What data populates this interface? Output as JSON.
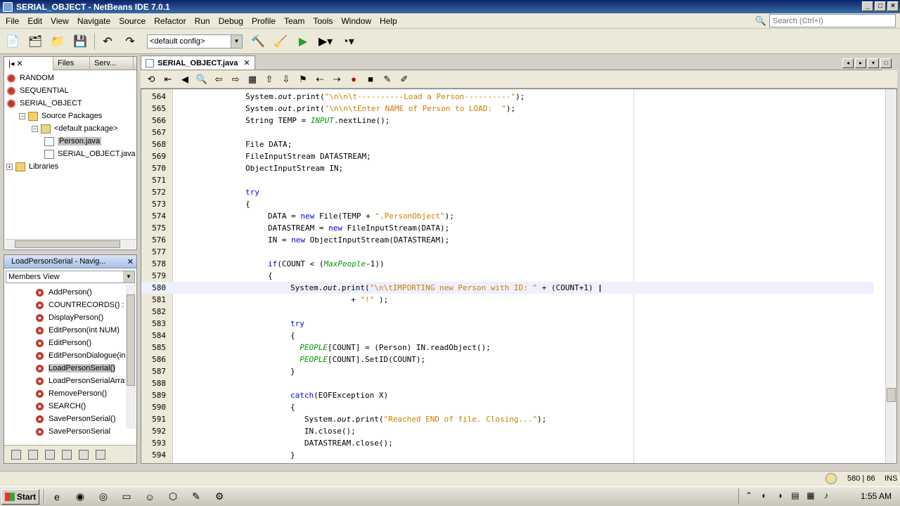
{
  "window": {
    "title": "SERIAL_OBJECT - NetBeans IDE 7.0.1"
  },
  "menu": [
    "File",
    "Edit",
    "View",
    "Navigate",
    "Source",
    "Refactor",
    "Run",
    "Debug",
    "Profile",
    "Team",
    "Tools",
    "Window",
    "Help"
  ],
  "search": {
    "placeholder": "Search (Ctrl+I)"
  },
  "toolbar": {
    "config": "<default config>"
  },
  "projects_panel": {
    "tabs": [
      "Files",
      "Serv..."
    ],
    "tree": [
      {
        "label": "RANDOM",
        "indent": 0,
        "icon": "project-icon"
      },
      {
        "label": "SEQUENTIAL",
        "indent": 0,
        "icon": "project-icon"
      },
      {
        "label": "SERIAL_OBJECT",
        "indent": 0,
        "icon": "project-icon"
      },
      {
        "label": "Source Packages",
        "indent": 1,
        "icon": "folder-icon"
      },
      {
        "label": "<default package>",
        "indent": 2,
        "icon": "package-icon"
      },
      {
        "label": "Person.java",
        "indent": 3,
        "icon": "java-file-icon",
        "selected": true
      },
      {
        "label": "SERIAL_OBJECT.java",
        "indent": 3,
        "icon": "java-file-icon"
      },
      {
        "label": "Libraries",
        "indent": 0,
        "icon": "folder-icon"
      }
    ]
  },
  "navigator": {
    "title": "LoadPersonSerial - Navig...",
    "view": "Members View",
    "members": [
      "AddPerson()",
      "COUNTRECORDS() : int",
      "DisplayPerson()",
      "EditPerson(int NUM)",
      "EditPerson()",
      "EditPersonDialogue(int",
      "LoadPersonSerial()",
      "LoadPersonSerialArray",
      "RemovePerson()",
      "SEARCH()",
      "SavePersonSerial()",
      "SavePersonSerial"
    ],
    "selected_index": 6
  },
  "editor": {
    "tab": "SERIAL_OBJECT.java",
    "current_line": 580,
    "lines": [
      {
        "n": "564",
        "ind": 0,
        "html": "System.<span class=\"static\">out</span>.print(<span class=\"str\">\"\\n\\n\\t----------Load a Person----------\"</span>);"
      },
      {
        "n": "565",
        "ind": 0,
        "html": "System.<span class=\"static\">out</span>.print(<span class=\"str\">\"\\n\\n\\tEnter NAME of Person to LOAD:  \"</span>);"
      },
      {
        "n": "566",
        "ind": 0,
        "html": "String TEMP = <span class=\"fld\">INPUT</span>.nextLine();"
      },
      {
        "n": "567",
        "ind": 0,
        "html": ""
      },
      {
        "n": "568",
        "ind": 0,
        "html": "File DATA;"
      },
      {
        "n": "569",
        "ind": 0,
        "html": "FileInputStream DATASTREAM;"
      },
      {
        "n": "570",
        "ind": 0,
        "html": "ObjectInputStream IN;"
      },
      {
        "n": "571",
        "ind": 0,
        "html": ""
      },
      {
        "n": "572",
        "ind": 0,
        "html": "<span class=\"kw\">try</span>"
      },
      {
        "n": "573",
        "ind": 0,
        "html": "{"
      },
      {
        "n": "574",
        "ind": 1,
        "html": "DATA = <span class=\"kw\">new</span> File(TEMP + <span class=\"str\">\".PersonObject\"</span>);"
      },
      {
        "n": "575",
        "ind": 1,
        "html": "DATASTREAM = <span class=\"kw\">new</span> FileInputStream(DATA);"
      },
      {
        "n": "576",
        "ind": 1,
        "html": "IN = <span class=\"kw\">new</span> ObjectInputStream(DATASTREAM);"
      },
      {
        "n": "577",
        "ind": 1,
        "html": ""
      },
      {
        "n": "578",
        "ind": 1,
        "html": "<span class=\"kw\">if</span>(COUNT &lt; (<span class=\"fld\">MaxPeople</span>-1))"
      },
      {
        "n": "579",
        "ind": 1,
        "html": "{"
      },
      {
        "n": "580",
        "ind": 2,
        "html": "System.<span class=\"static\">out</span>.print(<span class=\"str\">\"\\n\\tIMPORTING new Person with ID: \"</span> + (COUNT+1) <b>|</b>"
      },
      {
        "n": "581",
        "ind": 2,
        "html": "             + <span class=\"str\">\"!\"</span> );"
      },
      {
        "n": "582",
        "ind": 2,
        "html": ""
      },
      {
        "n": "583",
        "ind": 2,
        "html": "<span class=\"kw\">try</span>"
      },
      {
        "n": "584",
        "ind": 2,
        "html": "{"
      },
      {
        "n": "585",
        "ind": 2,
        "html": "  <span class=\"fld\">PEOPLE</span>[COUNT] = (Person) IN.readObject();"
      },
      {
        "n": "586",
        "ind": 2,
        "html": "  <span class=\"fld\">PEOPLE</span>[COUNT].SetID(COUNT);"
      },
      {
        "n": "587",
        "ind": 2,
        "html": "}"
      },
      {
        "n": "588",
        "ind": 2,
        "html": ""
      },
      {
        "n": "589",
        "ind": 2,
        "html": "<span class=\"kw\">catch</span>(EOFException X)"
      },
      {
        "n": "590",
        "ind": 2,
        "html": "{"
      },
      {
        "n": "591",
        "ind": 2,
        "html": "   System.<span class=\"static\">out</span>.print(<span class=\"str\">\"Reached END of file. Closing...\"</span>);"
      },
      {
        "n": "592",
        "ind": 2,
        "html": "   IN.close();"
      },
      {
        "n": "593",
        "ind": 2,
        "html": "   DATASTREAM.close();"
      },
      {
        "n": "594",
        "ind": 2,
        "html": "}"
      }
    ]
  },
  "status": {
    "position": "580 | 86",
    "mode": "INS"
  },
  "taskbar": {
    "start": "Start",
    "clock": "1:55 AM"
  }
}
